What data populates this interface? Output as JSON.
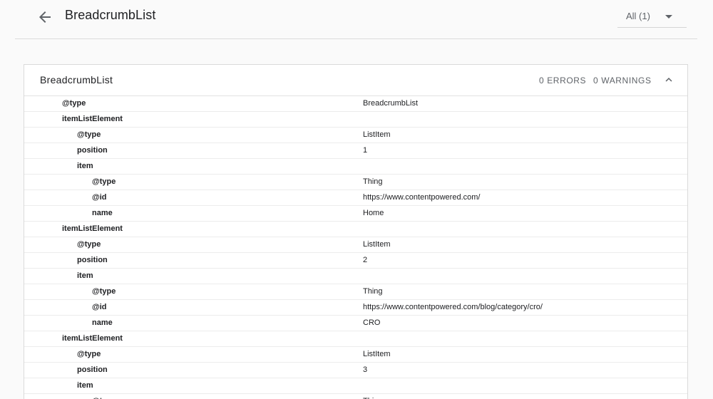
{
  "header": {
    "title": "BreadcrumbList",
    "filter_value": "All (1)"
  },
  "card": {
    "title": "BreadcrumbList",
    "errors": "0 ERRORS",
    "warnings": "0 WARNINGS"
  },
  "rows": [
    {
      "key": "@type",
      "value": "BreadcrumbList",
      "level": 0
    },
    {
      "key": "itemListElement",
      "value": "",
      "level": 0
    },
    {
      "key": "@type",
      "value": "ListItem",
      "level": 1
    },
    {
      "key": "position",
      "value": "1",
      "level": 1
    },
    {
      "key": "item",
      "value": "",
      "level": 1
    },
    {
      "key": "@type",
      "value": "Thing",
      "level": 2
    },
    {
      "key": "@id",
      "value": "https://www.contentpowered.com/",
      "level": 2
    },
    {
      "key": "name",
      "value": "Home",
      "level": 2
    },
    {
      "key": "itemListElement",
      "value": "",
      "level": 0
    },
    {
      "key": "@type",
      "value": "ListItem",
      "level": 1
    },
    {
      "key": "position",
      "value": "2",
      "level": 1
    },
    {
      "key": "item",
      "value": "",
      "level": 1
    },
    {
      "key": "@type",
      "value": "Thing",
      "level": 2
    },
    {
      "key": "@id",
      "value": "https://www.contentpowered.com/blog/category/cro/",
      "level": 2
    },
    {
      "key": "name",
      "value": "CRO",
      "level": 2
    },
    {
      "key": "itemListElement",
      "value": "",
      "level": 0
    },
    {
      "key": "@type",
      "value": "ListItem",
      "level": 1
    },
    {
      "key": "position",
      "value": "3",
      "level": 1
    },
    {
      "key": "item",
      "value": "",
      "level": 1
    },
    {
      "key": "@type",
      "value": "Thing",
      "level": 2
    }
  ]
}
